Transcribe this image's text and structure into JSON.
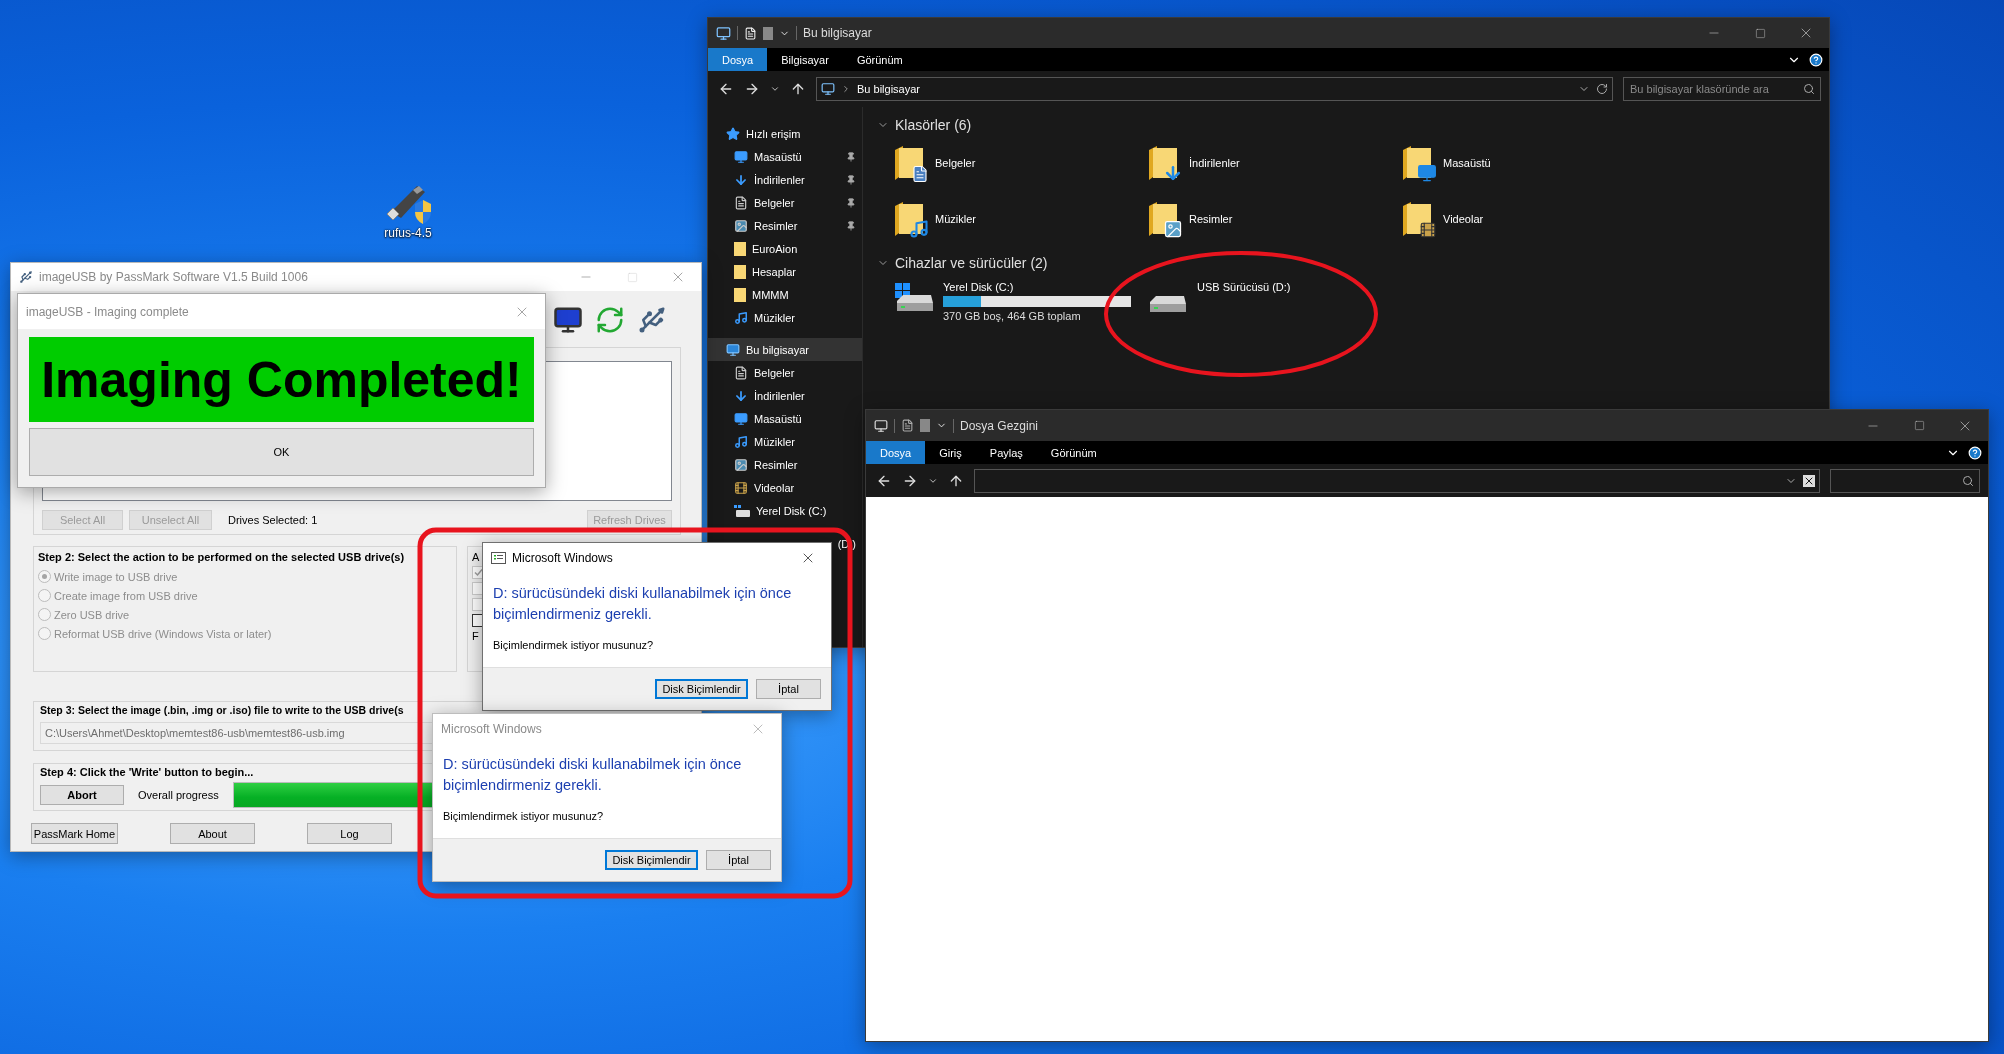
{
  "desktop": {
    "icons": [
      {
        "label": "rufus-4.5"
      }
    ]
  },
  "image_usb": {
    "title": "imageUSB by PassMark Software V1.5 Build 1006",
    "drive_buttons": [
      {
        "label": "Select All",
        "disabled": true
      },
      {
        "label": "Unselect All",
        "disabled": true
      }
    ],
    "drives_selected": "Drives Selected: 1",
    "refresh_button": {
      "label": "Refresh Drives",
      "disabled": true
    },
    "step2": {
      "heading": "Step 2: Select the action to be performed on the selected USB drive(s)",
      "options": [
        {
          "label": "Write image to USB drive",
          "selected": true,
          "disabled": true
        },
        {
          "label": "Create image from USB drive",
          "selected": false,
          "disabled": true
        },
        {
          "label": "Zero USB drive",
          "selected": false,
          "disabled": true
        },
        {
          "label": "Reformat USB drive (Windows Vista or later)",
          "selected": false,
          "disabled": true
        }
      ]
    },
    "side_group": {
      "label": "A",
      "options": [
        {
          "checked": true,
          "disabled": true
        },
        {
          "checked": false,
          "disabled": true
        },
        {
          "checked": false,
          "disabled": true
        },
        {
          "checked": false,
          "disabled": false
        }
      ],
      "footer": "F"
    },
    "step3": {
      "heading": "Step 3: Select the image (.bin, .img or .iso) file to write to the USB drive(s",
      "path": "C:\\Users\\Ahmet\\Desktop\\memtest86-usb\\memtest86-usb.img"
    },
    "step4": {
      "heading": "Step 4: Click the 'Write' button to begin...",
      "button": "Abort",
      "progress_label": "Overall progress",
      "level": 1
    },
    "footer_buttons": [
      "PassMark Home",
      "About",
      "Log"
    ]
  },
  "imaging_dialog": {
    "title": "imageUSB - Imaging complete",
    "banner": "Imaging Completed!",
    "button": "OK"
  },
  "explorer": {
    "title": "Bu bilgisayar",
    "ribbon_tabs": [
      {
        "label": "Dosya",
        "selected": true
      },
      {
        "label": "Bilgisayar",
        "selected": false
      },
      {
        "label": "Görünüm",
        "selected": false
      }
    ],
    "address": "Bu bilgisayar",
    "search_placeholder": "Bu bilgisayar klasöründe ara",
    "nav": [
      {
        "label": "Hızlı erişim",
        "kind": "star",
        "selected": false,
        "children": [
          {
            "label": "Masaüstü",
            "kind": "desktop",
            "selected": false,
            "pinned": true
          },
          {
            "label": "İndirilenler",
            "kind": "downloads",
            "selected": false,
            "pinned": true
          },
          {
            "label": "Belgeler",
            "kind": "documents",
            "selected": false,
            "pinned": true
          },
          {
            "label": "Resimler",
            "kind": "pictures",
            "selected": false,
            "pinned": true
          },
          {
            "label": "EuroAion",
            "kind": "folder",
            "selected": false,
            "pinned": false
          },
          {
            "label": "Hesaplar",
            "kind": "folder",
            "selected": false,
            "pinned": false
          },
          {
            "label": "MMMM",
            "kind": "folder",
            "selected": false,
            "pinned": false
          },
          {
            "label": "Müzikler",
            "kind": "music",
            "selected": false,
            "pinned": false
          }
        ]
      },
      {
        "label": "Bu bilgisayar",
        "kind": "computer",
        "selected": true,
        "children": [
          {
            "label": "Belgeler",
            "kind": "documents",
            "selected": false
          },
          {
            "label": "İndirilenler",
            "kind": "downloads",
            "selected": false
          },
          {
            "label": "Masaüstü",
            "kind": "desktop",
            "selected": false
          },
          {
            "label": "Müzikler",
            "kind": "music",
            "selected": false
          },
          {
            "label": "Resimler",
            "kind": "pictures",
            "selected": false
          },
          {
            "label": "Videolar",
            "kind": "videos",
            "selected": false
          },
          {
            "label": "Yerel Disk (C:)",
            "kind": "disk",
            "selected": false
          },
          {
            "label": "(D:)",
            "kind": "usb",
            "selected": false
          }
        ]
      }
    ],
    "folders_heading": "Klasörler (6)",
    "folders": [
      {
        "name": "Belgeler",
        "kind": "documents"
      },
      {
        "name": "İndirilenler",
        "kind": "downloads"
      },
      {
        "name": "Masaüstü",
        "kind": "desktop"
      },
      {
        "name": "Müzikler",
        "kind": "music"
      },
      {
        "name": "Resimler",
        "kind": "pictures"
      },
      {
        "name": "Videolar",
        "kind": "videos"
      }
    ],
    "drives_heading": "Cihazlar ve sürücüler (2)",
    "drives": [
      {
        "name": "Yerel Disk (C:)",
        "kind": "system",
        "level": 0.2,
        "info": "370 GB boş, 464 GB toplam"
      },
      {
        "name": "USB Sürücüsü (D:)",
        "kind": "usb"
      }
    ]
  },
  "explorer2": {
    "title": "Dosya Gezgini",
    "ribbon_tabs": [
      {
        "label": "Dosya",
        "selected": true
      },
      {
        "label": "Giriş",
        "selected": false
      },
      {
        "label": "Paylaş",
        "selected": false
      },
      {
        "label": "Görünüm",
        "selected": false
      }
    ]
  },
  "format_dialogs": [
    {
      "title": "Microsoft Windows",
      "active": true,
      "message": "D: sürücüsündeki diski kullanabilmek için önce biçimlendirmeniz gerekli.",
      "question": "Biçimlendirmek istiyor musunuz?",
      "buttons": [
        {
          "label": "Disk Biçimlendir",
          "default": true
        },
        {
          "label": "İptal",
          "default": false
        }
      ]
    },
    {
      "title": "Microsoft Windows",
      "active": false,
      "message": "D: sürücüsündeki diski kullanabilmek için önce biçimlendirmeniz gerekli.",
      "question": "Biçimlendirmek istiyor musunuz?",
      "buttons": [
        {
          "label": "Disk Biçimlendir",
          "default": true
        },
        {
          "label": "İptal",
          "default": false
        }
      ]
    }
  ],
  "annotations": [
    {
      "kind": "ellipse"
    },
    {
      "kind": "frame"
    }
  ]
}
